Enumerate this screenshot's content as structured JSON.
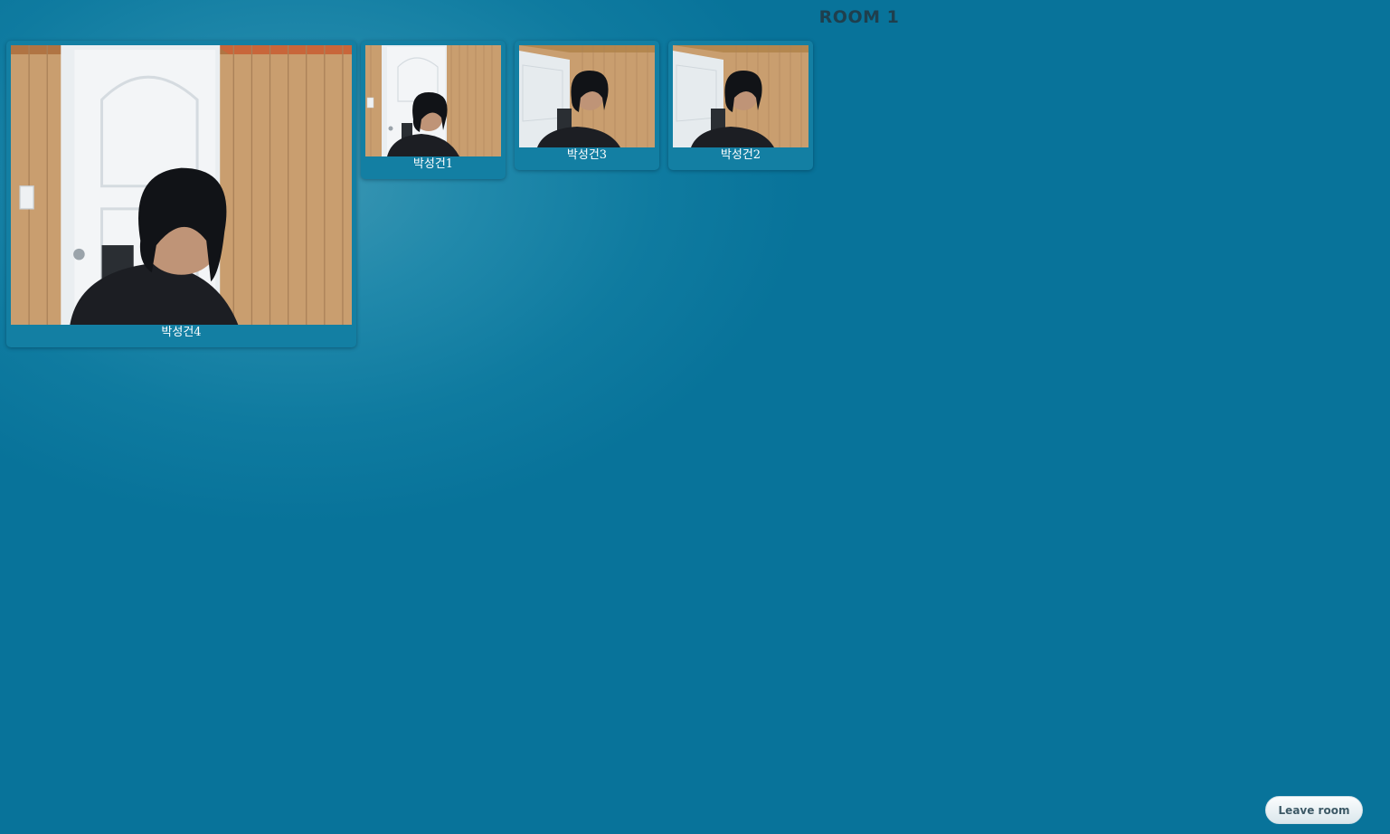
{
  "room": {
    "title": "ROOM 1"
  },
  "participants": [
    {
      "name": "박성건4"
    },
    {
      "name": "박성건1"
    },
    {
      "name": "박성건3"
    },
    {
      "name": "박성건2"
    }
  ],
  "controls": {
    "leave_label": "Leave room"
  },
  "colors": {
    "background": "#08739a",
    "tile": "#137fa3",
    "title_text": "#1f3f4d",
    "button_text": "#3d5966"
  },
  "icons": {
    "video_feed": "webcam-video-feed"
  }
}
